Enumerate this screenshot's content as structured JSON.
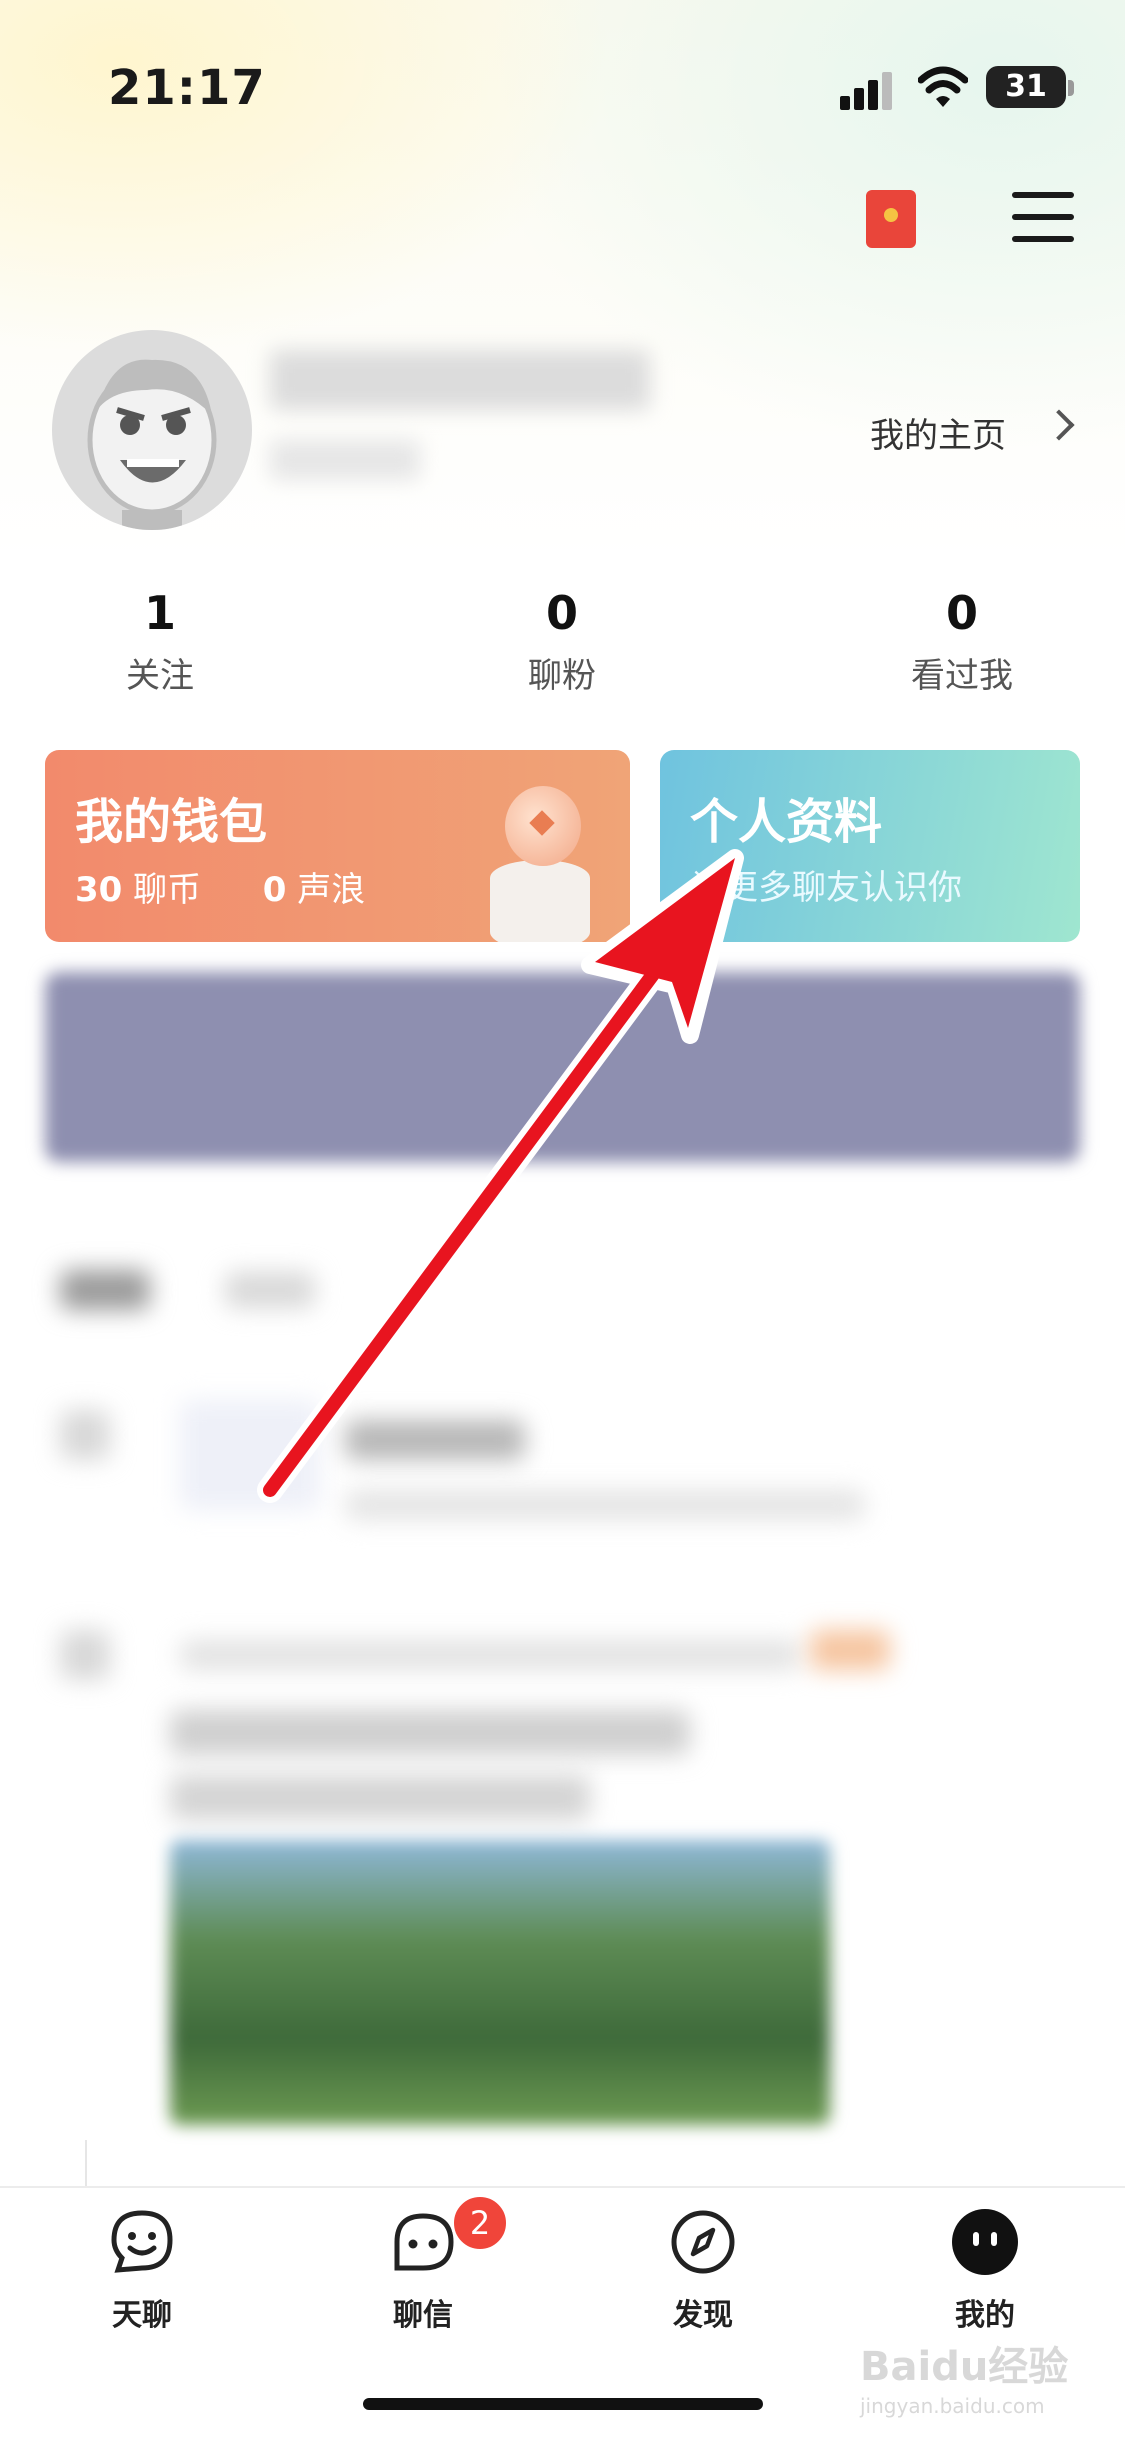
{
  "status_bar": {
    "time": "21:17",
    "battery": "31",
    "icons": [
      "signal-icon",
      "wifi-icon",
      "battery-icon"
    ]
  },
  "header": {
    "icons": [
      "red-packet-icon",
      "menu-icon"
    ]
  },
  "profile": {
    "homepage_label": "我的主页"
  },
  "stats": [
    {
      "value": "1",
      "label": "关注"
    },
    {
      "value": "0",
      "label": "聊粉"
    },
    {
      "value": "0",
      "label": "看过我"
    }
  ],
  "wallet_card": {
    "title": "我的钱包",
    "coins_value": "30",
    "coins_label": "聊币",
    "waves_value": "0",
    "waves_label": "声浪"
  },
  "profile_card": {
    "title": "个人资料",
    "subtitle": "让更多聊友认识你"
  },
  "tabbar": {
    "items": [
      {
        "label": "天聊",
        "icon": "smile-chat-icon"
      },
      {
        "label": "聊信",
        "icon": "message-icon",
        "badge": "2"
      },
      {
        "label": "发现",
        "icon": "compass-icon"
      },
      {
        "label": "我的",
        "icon": "me-icon"
      }
    ]
  },
  "watermark": {
    "text": "Baidu经验",
    "url": "jingyan.baidu.com"
  },
  "colors": {
    "wallet": "#f28a6c",
    "profile_card": "#6fc3df",
    "badge": "#f0453a",
    "arrow": "#e8141f"
  }
}
